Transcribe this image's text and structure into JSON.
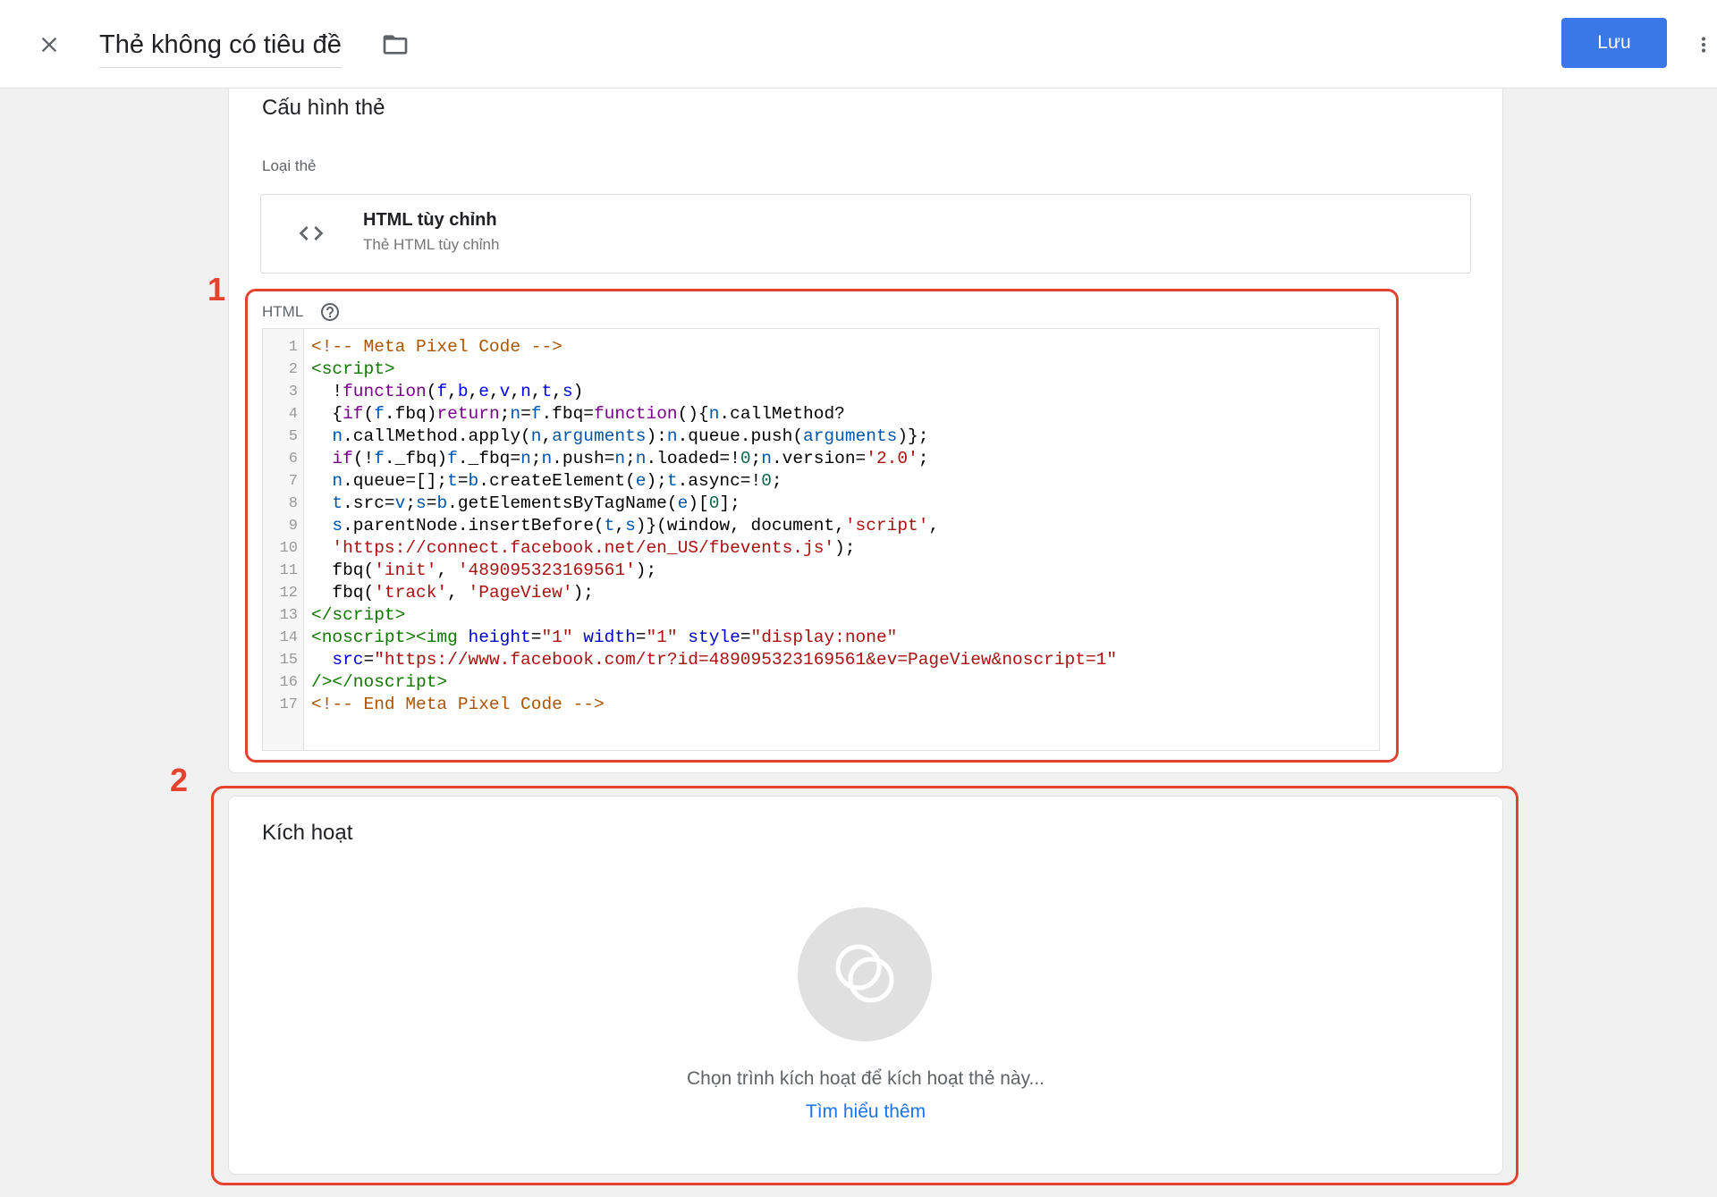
{
  "header": {
    "close_icon": "close-icon",
    "title": "Thẻ không có tiêu đề",
    "folder_icon": "folder-icon",
    "save_label": "Lưu",
    "more_icon": "more-vert-icon"
  },
  "tag_config": {
    "heading": "Cấu hình thẻ",
    "tag_type_label": "Loại thẻ",
    "tag_type": {
      "icon": "code-icon",
      "name": "HTML tùy chỉnh",
      "description": "Thẻ HTML tùy chỉnh"
    }
  },
  "html_editor": {
    "label": "HTML",
    "help_icon": "help-circle-icon",
    "lines": [
      {
        "number": 1,
        "tokens": [
          {
            "c": "#aa5500",
            "t": "<!-- Meta Pixel Code -->"
          }
        ]
      },
      {
        "number": 2,
        "tokens": [
          {
            "c": "#117700",
            "t": "<script>"
          }
        ]
      },
      {
        "number": 3,
        "tokens": [
          {
            "c": "#000000",
            "t": "  !"
          },
          {
            "c": "#770088",
            "t": "function"
          },
          {
            "c": "#000000",
            "t": "("
          },
          {
            "c": "#0000ff",
            "t": "f"
          },
          {
            "c": "#000000",
            "t": ","
          },
          {
            "c": "#0000ff",
            "t": "b"
          },
          {
            "c": "#000000",
            "t": ","
          },
          {
            "c": "#0000ff",
            "t": "e"
          },
          {
            "c": "#000000",
            "t": ","
          },
          {
            "c": "#0000ff",
            "t": "v"
          },
          {
            "c": "#000000",
            "t": ","
          },
          {
            "c": "#0000ff",
            "t": "n"
          },
          {
            "c": "#000000",
            "t": ","
          },
          {
            "c": "#0000ff",
            "t": "t"
          },
          {
            "c": "#000000",
            "t": ","
          },
          {
            "c": "#0000ff",
            "t": "s"
          },
          {
            "c": "#000000",
            "t": ")"
          }
        ]
      },
      {
        "number": 4,
        "tokens": [
          {
            "c": "#000000",
            "t": "  {"
          },
          {
            "c": "#770088",
            "t": "if"
          },
          {
            "c": "#000000",
            "t": "("
          },
          {
            "c": "#0055aa",
            "t": "f"
          },
          {
            "c": "#000000",
            "t": ".fbq)"
          },
          {
            "c": "#770088",
            "t": "return"
          },
          {
            "c": "#000000",
            "t": ";"
          },
          {
            "c": "#0055aa",
            "t": "n"
          },
          {
            "c": "#000000",
            "t": "="
          },
          {
            "c": "#0055aa",
            "t": "f"
          },
          {
            "c": "#000000",
            "t": ".fbq="
          },
          {
            "c": "#770088",
            "t": "function"
          },
          {
            "c": "#000000",
            "t": "(){"
          },
          {
            "c": "#0055aa",
            "t": "n"
          },
          {
            "c": "#000000",
            "t": ".callMethod?"
          }
        ]
      },
      {
        "number": 5,
        "tokens": [
          {
            "c": "#000000",
            "t": "  "
          },
          {
            "c": "#0055aa",
            "t": "n"
          },
          {
            "c": "#000000",
            "t": ".callMethod.apply("
          },
          {
            "c": "#0055aa",
            "t": "n"
          },
          {
            "c": "#000000",
            "t": ","
          },
          {
            "c": "#0055aa",
            "t": "arguments"
          },
          {
            "c": "#000000",
            "t": "):"
          },
          {
            "c": "#0055aa",
            "t": "n"
          },
          {
            "c": "#000000",
            "t": ".queue.push("
          },
          {
            "c": "#0055aa",
            "t": "arguments"
          },
          {
            "c": "#000000",
            "t": ")};"
          }
        ]
      },
      {
        "number": 6,
        "tokens": [
          {
            "c": "#000000",
            "t": "  "
          },
          {
            "c": "#770088",
            "t": "if"
          },
          {
            "c": "#000000",
            "t": "(!"
          },
          {
            "c": "#0055aa",
            "t": "f"
          },
          {
            "c": "#000000",
            "t": "._fbq)"
          },
          {
            "c": "#0055aa",
            "t": "f"
          },
          {
            "c": "#000000",
            "t": "._fbq="
          },
          {
            "c": "#0055aa",
            "t": "n"
          },
          {
            "c": "#000000",
            "t": ";"
          },
          {
            "c": "#0055aa",
            "t": "n"
          },
          {
            "c": "#000000",
            "t": ".push="
          },
          {
            "c": "#0055aa",
            "t": "n"
          },
          {
            "c": "#000000",
            "t": ";"
          },
          {
            "c": "#0055aa",
            "t": "n"
          },
          {
            "c": "#000000",
            "t": ".loaded=!"
          },
          {
            "c": "#116644",
            "t": "0"
          },
          {
            "c": "#000000",
            "t": ";"
          },
          {
            "c": "#0055aa",
            "t": "n"
          },
          {
            "c": "#000000",
            "t": ".version="
          },
          {
            "c": "#aa1111",
            "t": "'2.0'"
          },
          {
            "c": "#000000",
            "t": ";"
          }
        ]
      },
      {
        "number": 7,
        "tokens": [
          {
            "c": "#000000",
            "t": "  "
          },
          {
            "c": "#0055aa",
            "t": "n"
          },
          {
            "c": "#000000",
            "t": ".queue=[];"
          },
          {
            "c": "#0055aa",
            "t": "t"
          },
          {
            "c": "#000000",
            "t": "="
          },
          {
            "c": "#0055aa",
            "t": "b"
          },
          {
            "c": "#000000",
            "t": ".createElement("
          },
          {
            "c": "#0055aa",
            "t": "e"
          },
          {
            "c": "#000000",
            "t": ");"
          },
          {
            "c": "#0055aa",
            "t": "t"
          },
          {
            "c": "#000000",
            "t": ".async=!"
          },
          {
            "c": "#116644",
            "t": "0"
          },
          {
            "c": "#000000",
            "t": ";"
          }
        ]
      },
      {
        "number": 8,
        "tokens": [
          {
            "c": "#000000",
            "t": "  "
          },
          {
            "c": "#0055aa",
            "t": "t"
          },
          {
            "c": "#000000",
            "t": ".src="
          },
          {
            "c": "#0055aa",
            "t": "v"
          },
          {
            "c": "#000000",
            "t": ";"
          },
          {
            "c": "#0055aa",
            "t": "s"
          },
          {
            "c": "#000000",
            "t": "="
          },
          {
            "c": "#0055aa",
            "t": "b"
          },
          {
            "c": "#000000",
            "t": ".getElementsByTagName("
          },
          {
            "c": "#0055aa",
            "t": "e"
          },
          {
            "c": "#000000",
            "t": ")["
          },
          {
            "c": "#116644",
            "t": "0"
          },
          {
            "c": "#000000",
            "t": "];"
          }
        ]
      },
      {
        "number": 9,
        "tokens": [
          {
            "c": "#000000",
            "t": "  "
          },
          {
            "c": "#0055aa",
            "t": "s"
          },
          {
            "c": "#000000",
            "t": ".parentNode.insertBefore("
          },
          {
            "c": "#0055aa",
            "t": "t"
          },
          {
            "c": "#000000",
            "t": ","
          },
          {
            "c": "#0055aa",
            "t": "s"
          },
          {
            "c": "#000000",
            "t": ")}(window, document,"
          },
          {
            "c": "#aa1111",
            "t": "'script'"
          },
          {
            "c": "#000000",
            "t": ","
          }
        ]
      },
      {
        "number": 10,
        "tokens": [
          {
            "c": "#000000",
            "t": "  "
          },
          {
            "c": "#aa1111",
            "t": "'https://connect.facebook.net/en_US/fbevents.js'"
          },
          {
            "c": "#000000",
            "t": ");"
          }
        ]
      },
      {
        "number": 11,
        "tokens": [
          {
            "c": "#000000",
            "t": "  fbq("
          },
          {
            "c": "#aa1111",
            "t": "'init'"
          },
          {
            "c": "#000000",
            "t": ", "
          },
          {
            "c": "#aa1111",
            "t": "'489095323169561'"
          },
          {
            "c": "#000000",
            "t": ");"
          }
        ]
      },
      {
        "number": 12,
        "tokens": [
          {
            "c": "#000000",
            "t": "  fbq("
          },
          {
            "c": "#aa1111",
            "t": "'track'"
          },
          {
            "c": "#000000",
            "t": ", "
          },
          {
            "c": "#aa1111",
            "t": "'PageView'"
          },
          {
            "c": "#000000",
            "t": ");"
          }
        ]
      },
      {
        "number": 13,
        "tokens": [
          {
            "c": "#117700",
            "t": "</script>"
          }
        ]
      },
      {
        "number": 14,
        "tokens": [
          {
            "c": "#117700",
            "t": "<noscript><img"
          },
          {
            "c": "#000000",
            "t": " "
          },
          {
            "c": "#0000cc",
            "t": "height"
          },
          {
            "c": "#000000",
            "t": "="
          },
          {
            "c": "#aa1111",
            "t": "\"1\""
          },
          {
            "c": "#000000",
            "t": " "
          },
          {
            "c": "#0000cc",
            "t": "width"
          },
          {
            "c": "#000000",
            "t": "="
          },
          {
            "c": "#aa1111",
            "t": "\"1\""
          },
          {
            "c": "#000000",
            "t": " "
          },
          {
            "c": "#0000cc",
            "t": "style"
          },
          {
            "c": "#000000",
            "t": "="
          },
          {
            "c": "#aa1111",
            "t": "\"display:none\""
          }
        ]
      },
      {
        "number": 15,
        "tokens": [
          {
            "c": "#000000",
            "t": "  "
          },
          {
            "c": "#0000cc",
            "t": "src"
          },
          {
            "c": "#000000",
            "t": "="
          },
          {
            "c": "#aa1111",
            "t": "\"https://www.facebook.com/tr?id=489095323169561&ev=PageView&noscript=1\""
          }
        ]
      },
      {
        "number": 16,
        "tokens": [
          {
            "c": "#117700",
            "t": "/></noscript>"
          }
        ]
      },
      {
        "number": 17,
        "tokens": [
          {
            "c": "#aa5500",
            "t": "<!-- End Meta Pixel Code -->"
          }
        ]
      }
    ]
  },
  "triggering": {
    "heading": "Kích hoạt",
    "icon": "trigger-icon",
    "empty_text": "Chọn trình kích hoạt để kích hoạt thẻ này...",
    "learn_more": "Tìm hiểu thêm"
  },
  "annotations": {
    "box_1_label": "1",
    "box_2_label": "2"
  },
  "colors": {
    "primary_button": "#3b78e7",
    "annotation": "#e5432e",
    "link": "#1a73e8"
  }
}
